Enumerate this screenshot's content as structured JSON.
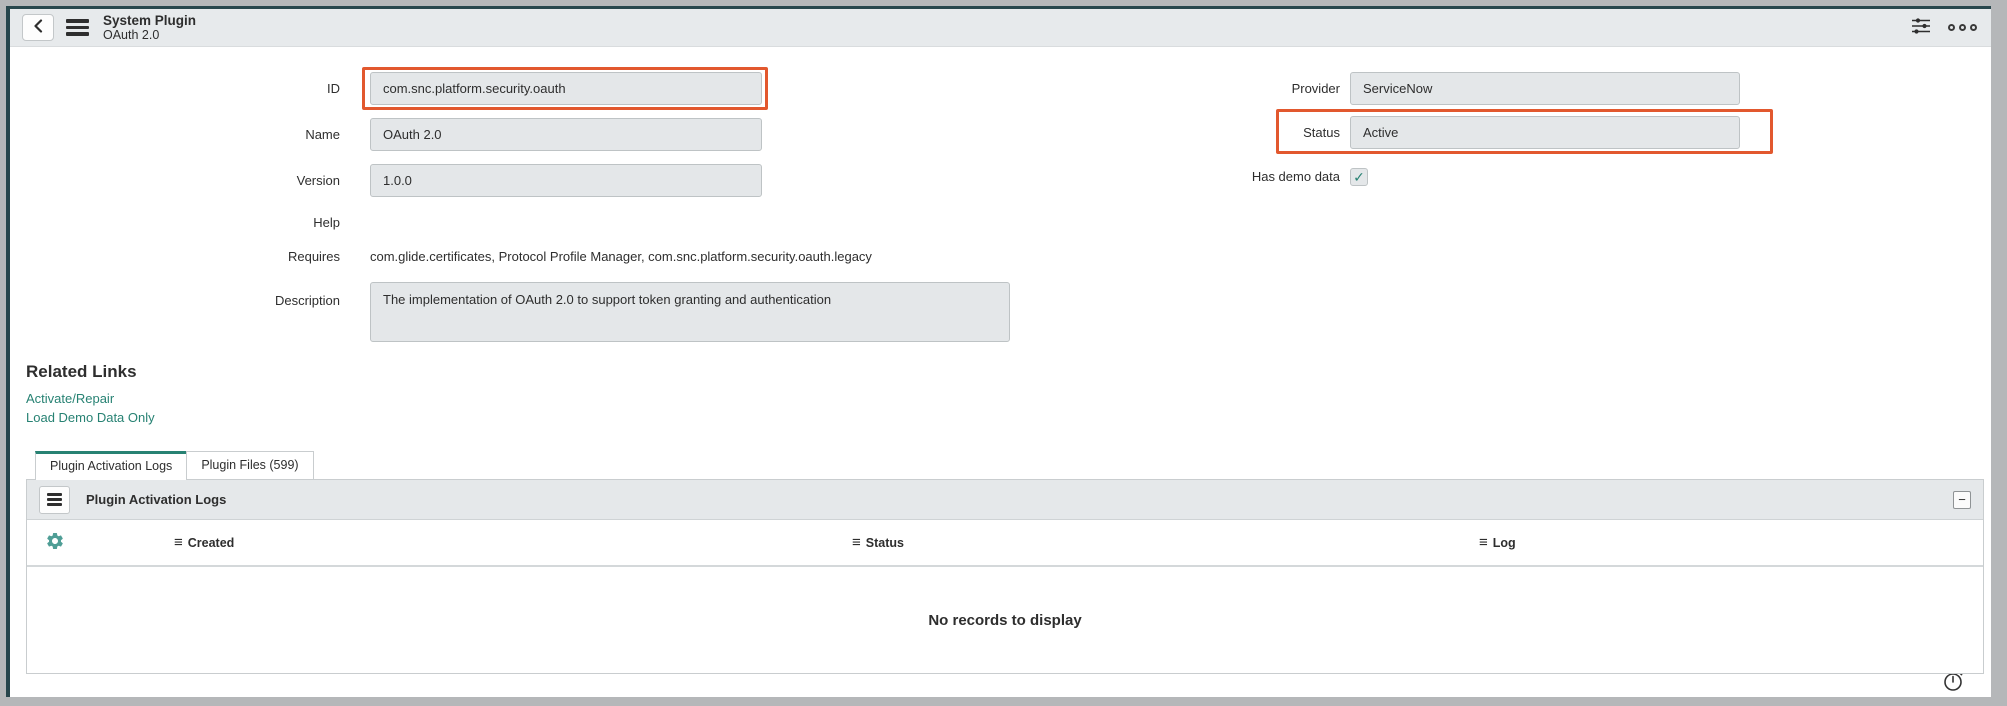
{
  "colors": {
    "accent_teal": "#278273",
    "highlight_red": "#e2582e",
    "header_bg": "#e7eaec",
    "readonly_field_bg": "#e4e7e9",
    "frame_dark": "#27464c",
    "frame_gray": "#b5b7b9"
  },
  "header": {
    "title": "System Plugin",
    "subtitle": "OAuth 2.0"
  },
  "icons": {
    "back": "chevron-left",
    "nav_menu": "hamburger",
    "personalize": "sliders",
    "more": "three-circles",
    "list_menu": "hamburger",
    "gear": "gear",
    "column_menu_glyph": "≡",
    "check_glyph": "✓",
    "collapse_glyph": "−",
    "timer": "stopwatch"
  },
  "form": {
    "fields": {
      "id": {
        "label": "ID",
        "value": "com.snc.platform.security.oauth",
        "highlighted": true
      },
      "name": {
        "label": "Name",
        "value": "OAuth 2.0"
      },
      "version": {
        "label": "Version",
        "value": "1.0.0"
      },
      "help": {
        "label": "Help",
        "value": ""
      },
      "requires": {
        "label": "Requires",
        "value": "com.glide.certificates, Protocol Profile Manager, com.snc.platform.security.oauth.legacy"
      },
      "description": {
        "label": "Description",
        "value": "The implementation of OAuth 2.0 to support token granting and authentication"
      },
      "provider": {
        "label": "Provider",
        "value": "ServiceNow"
      },
      "status": {
        "label": "Status",
        "value": "Active",
        "highlighted": true
      },
      "has_demo_data": {
        "label": "Has demo data",
        "checked": true
      }
    }
  },
  "related_links": {
    "title": "Related Links",
    "links": [
      {
        "label": "Activate/Repair"
      },
      {
        "label": "Load Demo Data Only"
      }
    ]
  },
  "tabs": [
    {
      "label": "Plugin Activation Logs",
      "active": true
    },
    {
      "label": "Plugin Files (599)",
      "active": false
    }
  ],
  "list": {
    "title": "Plugin Activation Logs",
    "columns": [
      {
        "label": "Created"
      },
      {
        "label": "Status"
      },
      {
        "label": "Log"
      }
    ],
    "empty_message": "No records to display"
  }
}
